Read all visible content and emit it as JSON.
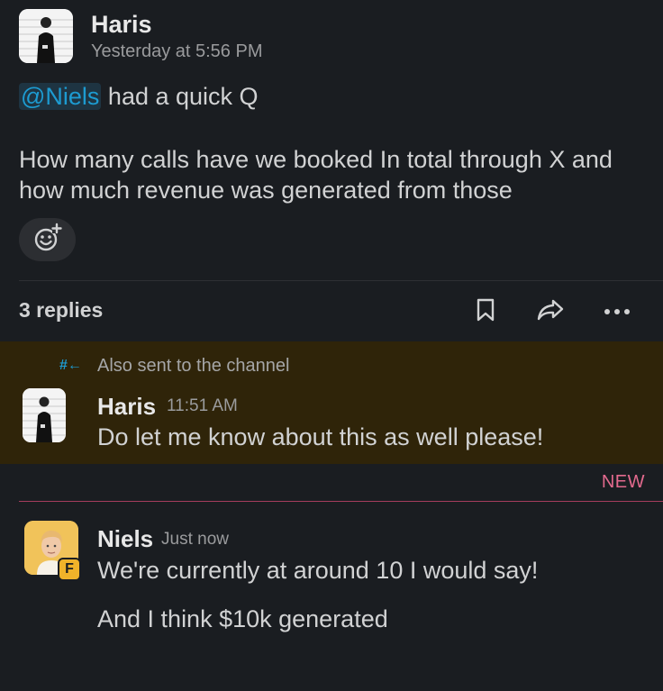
{
  "parent": {
    "author": "Haris",
    "timestamp": "Yesterday at 5:56 PM",
    "mention": "@Niels",
    "line1_rest": " had a quick Q",
    "body": "How many calls have we booked In total through X and how much revenue was generated from those"
  },
  "thread": {
    "replies_label": "3 replies"
  },
  "channel_reply": {
    "sent_label": "Also sent to the channel",
    "author": "Haris",
    "timestamp": "11:51 AM",
    "text": "Do let me know about this as well please!"
  },
  "new_marker": {
    "label": "NEW",
    "color": "#e36a8e"
  },
  "latest_reply": {
    "author": "Niels",
    "timestamp": "Just now",
    "badge": "F",
    "line1": "We're currently at around 10 I would say!",
    "line2": "And I think $10k generated"
  },
  "colors": {
    "background": "#1a1d21",
    "mention": "#1d9bd1",
    "highlight": "#2f2409"
  },
  "icons": [
    "add-reaction-icon",
    "bookmark-icon",
    "share-icon",
    "more-icon",
    "sent-to-channel-icon"
  ]
}
